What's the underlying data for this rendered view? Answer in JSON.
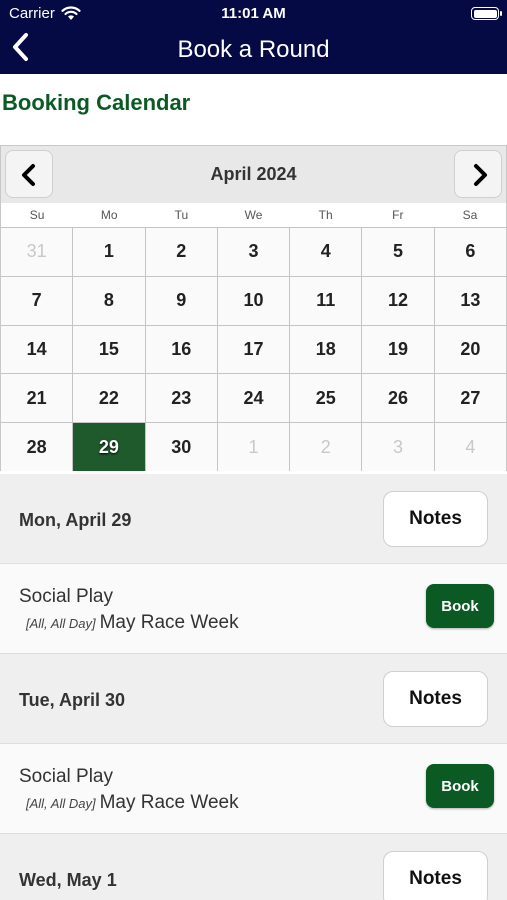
{
  "status_bar": {
    "carrier": "Carrier",
    "time": "11:01 AM"
  },
  "nav": {
    "title": "Book a Round",
    "back_icon": "chevron-left-icon"
  },
  "header": {
    "title": "Booking Calendar"
  },
  "calendar": {
    "month_label": "April 2024",
    "weekdays": [
      "Su",
      "Mo",
      "Tu",
      "We",
      "Th",
      "Fr",
      "Sa"
    ],
    "days": [
      "31",
      "1",
      "2",
      "3",
      "4",
      "5",
      "6",
      "7",
      "8",
      "9",
      "10",
      "11",
      "12",
      "13",
      "14",
      "15",
      "16",
      "17",
      "18",
      "19",
      "20",
      "21",
      "22",
      "23",
      "24",
      "25",
      "26",
      "27",
      "28",
      "29",
      "30",
      "1",
      "2",
      "3",
      "4"
    ],
    "selected_day": "29"
  },
  "schedule": {
    "days": [
      {
        "label": "Mon, April 29",
        "notes_label": "Notes",
        "event": {
          "name": "Social Play",
          "meta": "[All, All Day]",
          "subtitle": "May Race Week",
          "book_label": "Book"
        }
      },
      {
        "label": "Tue, April 30",
        "notes_label": "Notes",
        "event": {
          "name": "Social Play",
          "meta": "[All, All Day]",
          "subtitle": "May Race Week",
          "book_label": "Book"
        }
      },
      {
        "label": "Wed, May 1",
        "notes_label": "Notes"
      }
    ]
  },
  "colors": {
    "nav_bg": "#050a45",
    "accent_green": "#0b5a24",
    "selected_day": "#1f5a2c"
  }
}
